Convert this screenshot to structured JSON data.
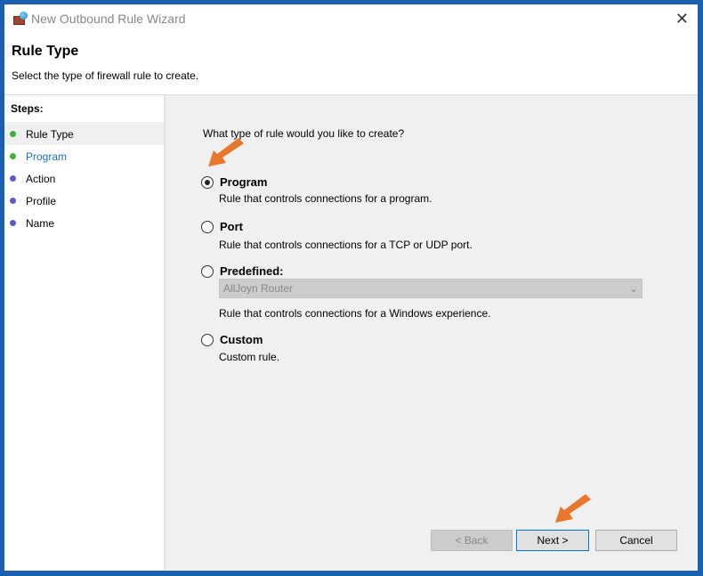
{
  "window": {
    "title": "New Outbound Rule Wizard",
    "close": "✕"
  },
  "header": {
    "title": "Rule Type",
    "subtitle": "Select the type of firewall rule to create."
  },
  "steps": {
    "heading": "Steps:",
    "items": [
      {
        "label": "Rule Type",
        "color": "#3cb43c",
        "current": true
      },
      {
        "label": "Program",
        "color": "#3cb43c",
        "link": true
      },
      {
        "label": "Action",
        "color": "#5a5ad0"
      },
      {
        "label": "Profile",
        "color": "#5a5ad0"
      },
      {
        "label": "Name",
        "color": "#5a5ad0"
      }
    ]
  },
  "main": {
    "question": "What type of rule would you like to create?",
    "options": [
      {
        "label": "Program",
        "desc": "Rule that controls connections for a program.",
        "selected": true
      },
      {
        "label": "Port",
        "desc": "Rule that controls connections for a TCP or UDP port."
      },
      {
        "label": "Predefined:",
        "desc": "Rule that controls connections for a Windows experience.",
        "select_value": "AllJoyn Router"
      },
      {
        "label": "Custom",
        "desc": "Custom rule."
      }
    ]
  },
  "buttons": {
    "back": "< Back",
    "next": "Next >",
    "cancel": "Cancel"
  },
  "colors": {
    "accent": "#0078d7",
    "arrow": "#e8762b"
  }
}
